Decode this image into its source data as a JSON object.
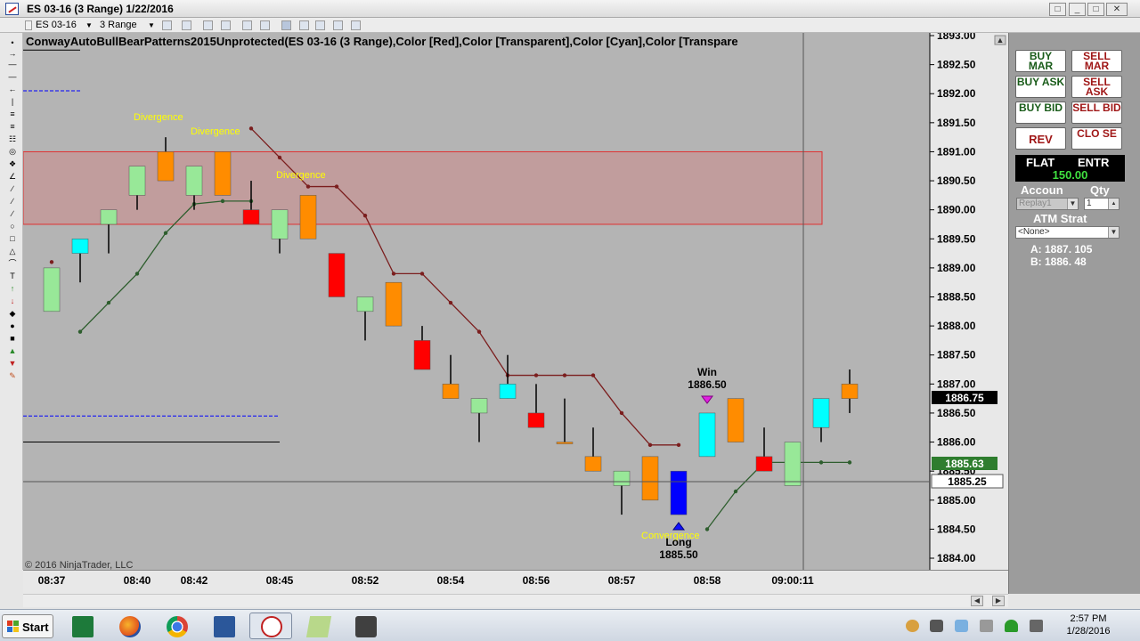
{
  "window": {
    "title": "ES 03-16 (3 Range)  1/22/2016"
  },
  "toolbar": {
    "instrument": "ES 03-16",
    "interval": "3 Range"
  },
  "chart": {
    "indicator_label": "ConwayAutoBullBearPatterns2015Unprotected(ES 03-16 (3 Range),Color [Red],Color [Transparent],Color [Cyan],Color [Transpare",
    "copyright": "© 2016 NinjaTrader, LLC",
    "price_axis": [
      "1893.00",
      "1892.50",
      "1892.00",
      "1891.50",
      "1891.00",
      "1890.50",
      "1890.00",
      "1889.50",
      "1889.00",
      "1888.50",
      "1888.00",
      "1887.50",
      "1887.00",
      "1886.50",
      "1886.00",
      "1885.50",
      "1885.00",
      "1884.50",
      "1884.00"
    ],
    "time_axis": [
      "08:37",
      "08:40",
      "08:42",
      "08:45",
      "08:52",
      "08:54",
      "08:56",
      "08:57",
      "08:58",
      "09:00:11"
    ],
    "price_markers": {
      "last": "1886.75",
      "green": "1885.63",
      "crosshair": "1885.25"
    },
    "annotations": {
      "divergence1": "Divergence",
      "divergence2": "Divergence",
      "divergence3": "Divergence",
      "convergence": "Convergence",
      "win_title": "Win",
      "win_price": "1886.50",
      "long_title": "Long",
      "long_price": "1885.50"
    }
  },
  "order_panel": {
    "buy_mar": "BUY MAR",
    "sell_mar": "SELL MAR",
    "buy_ask": "BUY ASK",
    "sell_ask": "SELL ASK",
    "buy_bid": "BUY BID",
    "sell_bid": "SELL BID",
    "rev": "REV",
    "close": "CLO SE",
    "flat": "FLAT",
    "entr": "ENTR",
    "position_price": "150.00",
    "account_label": "Accoun",
    "qty_label": "Qty",
    "account_value": "Replay1",
    "qty_value": "1",
    "atm_label": "ATM Strat",
    "atm_value": "<None>",
    "ask": "A: 1887. 105",
    "bid": "B: 1886. 48"
  },
  "taskbar": {
    "start": "Start",
    "time": "2:57 PM",
    "date": "1/28/2016"
  },
  "chart_data": {
    "type": "candlestick",
    "y_range": [
      1884.0,
      1893.0
    ],
    "x_labels": [
      "08:37",
      "08:40",
      "08:42",
      "08:45",
      "08:52",
      "08:54",
      "08:56",
      "08:57",
      "08:58",
      "09:00:11"
    ],
    "zone": {
      "low": 1889.75,
      "high": 1891.0
    },
    "level_lines": [
      {
        "price": 1892.75,
        "color": "#000000",
        "style": "solid"
      },
      {
        "price": 1892.05,
        "color": "#0000ff",
        "style": "dashed"
      },
      {
        "price": 1886.45,
        "color": "#0000ff",
        "style": "dashed"
      },
      {
        "price": 1886.0,
        "color": "#000000",
        "style": "solid"
      }
    ],
    "bars": [
      {
        "o": 1888.25,
        "h": 1889.0,
        "l": 1888.25,
        "c": 1889.0,
        "color": "#98e898"
      },
      {
        "o": 1889.5,
        "h": 1889.5,
        "l": 1888.75,
        "c": 1889.25,
        "color": "#00ffff"
      },
      {
        "o": 1889.75,
        "h": 1890.0,
        "l": 1889.25,
        "c": 1890.0,
        "color": "#98e898"
      },
      {
        "o": 1890.25,
        "h": 1890.75,
        "l": 1890.0,
        "c": 1890.75,
        "color": "#98e898"
      },
      {
        "o": 1891.0,
        "h": 1891.25,
        "l": 1890.5,
        "c": 1890.5,
        "color": "#ff8c00"
      },
      {
        "o": 1890.25,
        "h": 1890.75,
        "l": 1890.0,
        "c": 1890.75,
        "color": "#98e898"
      },
      {
        "o": 1891.0,
        "h": 1891.0,
        "l": 1890.25,
        "c": 1890.25,
        "color": "#ff8c00"
      },
      {
        "o": 1890.0,
        "h": 1890.5,
        "l": 1889.75,
        "c": 1889.75,
        "color": "#ff0000"
      },
      {
        "o": 1889.5,
        "h": 1890.0,
        "l": 1889.25,
        "c": 1890.0,
        "color": "#98e898"
      },
      {
        "o": 1890.25,
        "h": 1890.25,
        "l": 1889.5,
        "c": 1889.5,
        "color": "#ff8c00"
      },
      {
        "o": 1889.25,
        "h": 1889.25,
        "l": 1888.5,
        "c": 1888.5,
        "color": "#ff0000"
      },
      {
        "o": 1888.25,
        "h": 1888.5,
        "l": 1887.75,
        "c": 1888.5,
        "color": "#98e898"
      },
      {
        "o": 1888.75,
        "h": 1888.75,
        "l": 1888.0,
        "c": 1888.0,
        "color": "#ff8c00"
      },
      {
        "o": 1887.75,
        "h": 1888.0,
        "l": 1887.25,
        "c": 1887.25,
        "color": "#ff0000"
      },
      {
        "o": 1887.0,
        "h": 1887.5,
        "l": 1886.75,
        "c": 1886.75,
        "color": "#ff8c00"
      },
      {
        "o": 1886.5,
        "h": 1886.75,
        "l": 1886.0,
        "c": 1886.75,
        "color": "#98e898"
      },
      {
        "o": 1886.75,
        "h": 1887.5,
        "l": 1886.75,
        "c": 1887.0,
        "color": "#00ffff"
      },
      {
        "o": 1886.5,
        "h": 1887.0,
        "l": 1886.25,
        "c": 1886.25,
        "color": "#ff0000"
      },
      {
        "o": 1886.0,
        "h": 1886.75,
        "l": 1886.0,
        "c": 1886.0,
        "color": "#ff8c00"
      },
      {
        "o": 1885.75,
        "h": 1886.25,
        "l": 1885.5,
        "c": 1885.5,
        "color": "#ff8c00"
      },
      {
        "o": 1885.25,
        "h": 1885.5,
        "l": 1884.75,
        "c": 1885.5,
        "color": "#98e898"
      },
      {
        "o": 1885.75,
        "h": 1885.75,
        "l": 1885.0,
        "c": 1885.0,
        "color": "#ff8c00"
      },
      {
        "o": 1885.5,
        "h": 1885.5,
        "l": 1884.75,
        "c": 1884.75,
        "color": "#0000ff"
      },
      {
        "o": 1885.75,
        "h": 1886.5,
        "l": 1885.75,
        "c": 1886.5,
        "color": "#00ffff"
      },
      {
        "o": 1886.75,
        "h": 1886.75,
        "l": 1886.0,
        "c": 1886.0,
        "color": "#ff8c00"
      },
      {
        "o": 1885.75,
        "h": 1886.25,
        "l": 1885.5,
        "c": 1885.5,
        "color": "#ff0000"
      },
      {
        "o": 1885.25,
        "h": 1886.0,
        "l": 1885.25,
        "c": 1886.0,
        "color": "#98e898"
      },
      {
        "o": 1886.25,
        "h": 1886.75,
        "l": 1886.0,
        "c": 1886.75,
        "color": "#00ffff"
      },
      {
        "o": 1886.75,
        "h": 1887.25,
        "l": 1886.5,
        "c": 1887.0,
        "color": "#ff8c00"
      }
    ],
    "series": [
      {
        "name": "",
        "color": "#7b1e1e",
        "points": [
          [
            0,
            1889.1
          ],
          [
            7,
            1891.4
          ],
          [
            8,
            1890.9
          ],
          [
            9,
            1890.4
          ],
          [
            10,
            1890.4
          ],
          [
            11,
            1889.9
          ],
          [
            12,
            1888.9
          ],
          [
            13,
            1888.9
          ],
          [
            14,
            1888.4
          ],
          [
            15,
            1887.9
          ],
          [
            16,
            1887.15
          ],
          [
            17,
            1887.15
          ],
          [
            18,
            1887.15
          ],
          [
            19,
            1887.15
          ],
          [
            20,
            1886.5
          ],
          [
            21,
            1885.95
          ],
          [
            22,
            1885.95
          ]
        ]
      },
      {
        "name": "",
        "color": "#2e5e2e",
        "points": [
          [
            1,
            1887.9
          ],
          [
            2,
            1888.4
          ],
          [
            3,
            1888.9
          ],
          [
            4,
            1889.6
          ],
          [
            5,
            1890.1
          ],
          [
            6,
            1890.15
          ],
          [
            7,
            1890.15
          ],
          [
            23,
            1884.5
          ],
          [
            24,
            1885.15
          ],
          [
            25,
            1885.65
          ],
          [
            26,
            1885.65
          ],
          [
            27,
            1885.65
          ],
          [
            28,
            1885.65
          ]
        ]
      }
    ]
  }
}
